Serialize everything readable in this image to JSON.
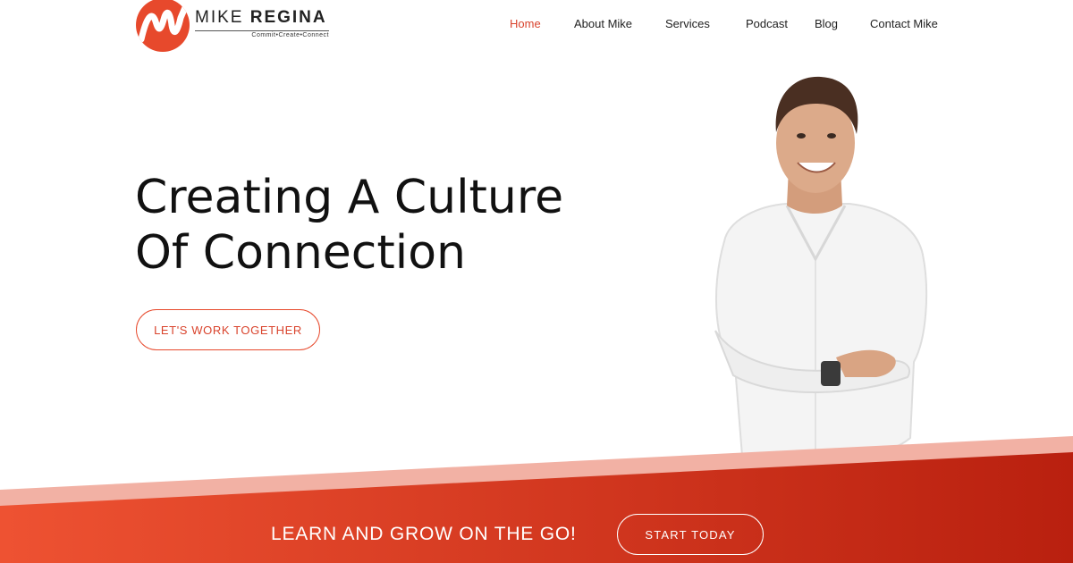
{
  "brand": {
    "first_name": "MIKE",
    "last_name": "REGINA",
    "tagline": "Commit•Create•Connect",
    "color": "#e7492c"
  },
  "nav": {
    "items": [
      {
        "label": "Home",
        "active": true
      },
      {
        "label": "About Mike",
        "active": false
      },
      {
        "label": "Services",
        "active": false
      },
      {
        "label": "Podcast",
        "active": false
      },
      {
        "label": "Blog",
        "active": false
      },
      {
        "label": "Contact Mike",
        "active": false
      }
    ],
    "active_color": "#d9432c"
  },
  "hero": {
    "headline_line1": "Creating A Culture",
    "headline_line2": "Of Connection",
    "cta_label": "LET'S WORK TOGETHER"
  },
  "portrait": {
    "description_icon": "person-portrait"
  },
  "banner": {
    "text": "LEARN AND GROW ON THE GO!",
    "cta_label": "START  TODAY",
    "gradient_start": "#ee5232",
    "gradient_end": "#b9200f",
    "stripe_color": "#f2b1a4"
  }
}
